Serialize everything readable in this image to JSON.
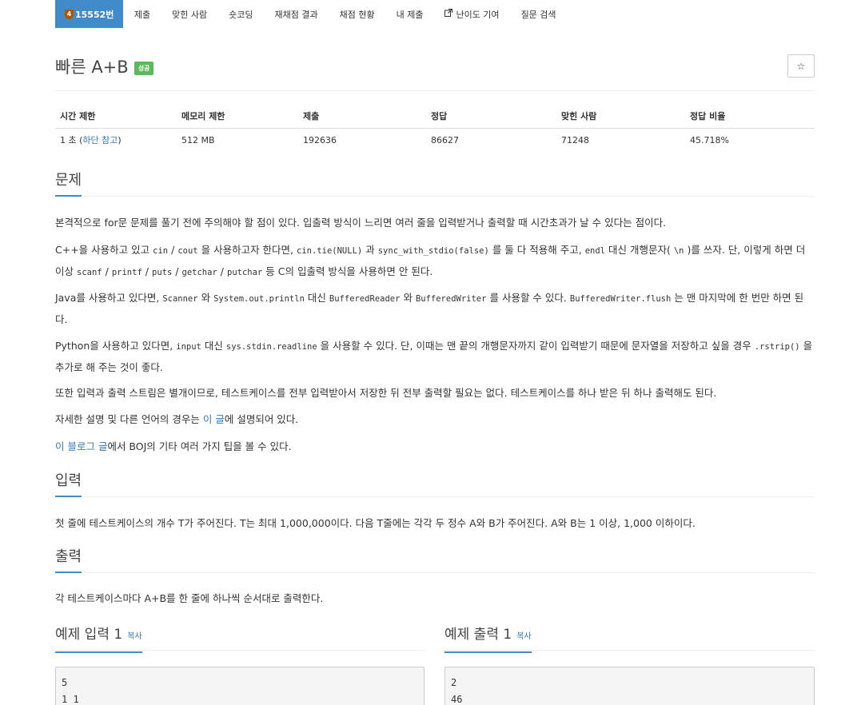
{
  "nav": {
    "tier_label": "4",
    "active": "15552번",
    "items": [
      "제출",
      "맞힌 사람",
      "숏코딩",
      "재채점 결과",
      "채점 현황",
      "내 제출",
      "난이도 기여",
      "질문 검색"
    ],
    "difficulty_icon": "external-link-icon"
  },
  "problem": {
    "title": "빠른 A+B",
    "badge": "성공",
    "star": "☆"
  },
  "info": {
    "headers": [
      "시간 제한",
      "메모리 제한",
      "제출",
      "정답",
      "맞힌 사람",
      "정답 비율"
    ],
    "time_prefix": "1 초 (",
    "time_link": "하단 참고",
    "time_suffix": ")",
    "memory": "512 MB",
    "submissions": "192636",
    "accepted": "86627",
    "solved": "71248",
    "ratio": "45.718%"
  },
  "sections": {
    "problem": "문제",
    "input": "입력",
    "output": "출력"
  },
  "desc": {
    "p1": "본격적으로 for문 문제를 풀기 전에 주의해야 할 점이 있다. 입출력 방식이 느리면 여러 줄을 입력받거나 출력할 때 시간초과가 날 수 있다는 점이다.",
    "p2": {
      "t1": "C++을 사용하고 있고",
      "c1": "cin",
      "t2": "/",
      "c2": "cout",
      "t3": "을 사용하고자 한다면,",
      "c3": "cin.tie(NULL)",
      "t4": "과",
      "c4": "sync_with_stdio(false)",
      "t5": "를 둘 다 적용해 주고,",
      "c5": "endl",
      "t6": "대신 개행문자(",
      "c6": "\\n",
      "t7": ")를 쓰자. 단, 이렇게 하면 더 이상",
      "c7": "scanf",
      "t8": "/",
      "c8": "printf",
      "t9": "/",
      "c9": "puts",
      "t10": "/",
      "c10": "getchar",
      "t11": "/",
      "c11": "putchar",
      "t12": "등 C의 입출력 방식을 사용하면 안 된다."
    },
    "p3": {
      "t1": "Java를 사용하고 있다면,",
      "c1": "Scanner",
      "t2": "와",
      "c2": "System.out.println",
      "t3": "대신",
      "c3": "BufferedReader",
      "t4": "와",
      "c4": "BufferedWriter",
      "t5": "를 사용할 수 있다.",
      "c5": "BufferedWriter.flush",
      "t6": "는 맨 마지막에 한 번만 하면 된다."
    },
    "p4": {
      "t1": "Python을 사용하고 있다면,",
      "c1": "input",
      "t2": "대신",
      "c2": "sys.stdin.readline",
      "t3": "을 사용할 수 있다. 단, 이때는 맨 끝의 개행문자까지 같이 입력받기 때문에 문자열을 저장하고 싶을 경우",
      "c3": ".rstrip()",
      "t4": "을 추가로 해 주는 것이 좋다."
    },
    "p5": "또한 입력과 출력 스트림은 별개이므로, 테스트케이스를 전부 입력받아서 저장한 뒤 전부 출력할 필요는 없다. 테스트케이스를 하나 받은 뒤 하나 출력해도 된다.",
    "p6": {
      "t1": "자세한 설명 및 다른 언어의 경우는",
      "link": "이 글",
      "t2": "에 설명되어 있다."
    },
    "p7": {
      "link": "이 블로그 글",
      "t1": "에서 BOJ의 기타 여러 가지 팁을 볼 수 있다."
    }
  },
  "input_text": "첫 줄에 테스트케이스의 개수 T가 주어진다. T는 최대 1,000,000이다. 다음 T줄에는 각각 두 정수 A와 B가 주어진다. A와 B는 1 이상, 1,000 이하이다.",
  "output_text": "각 테스트케이스마다 A+B를 한 줄에 하나씩 순서대로 출력한다.",
  "samples": {
    "input_title": "예제 입력 1",
    "output_title": "예제 출력 1",
    "copy": "복사",
    "input_lines": "5\n1 1",
    "output_lines": "2\n46"
  }
}
